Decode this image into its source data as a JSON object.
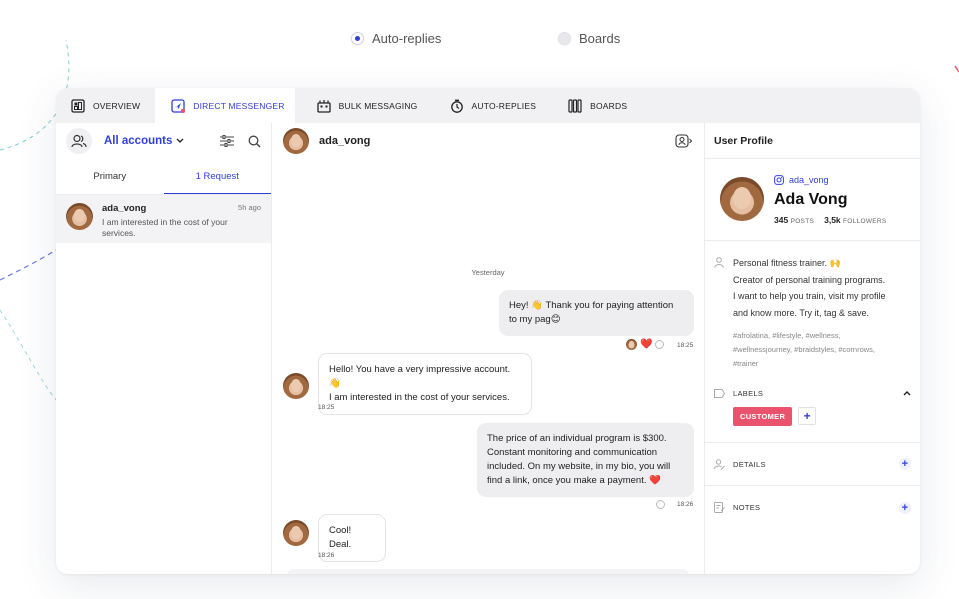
{
  "toggle": {
    "options": [
      {
        "label": "Auto-replies",
        "selected": true
      },
      {
        "label": "Boards",
        "selected": false
      }
    ]
  },
  "tabs": [
    {
      "label": "OVERVIEW",
      "icon": "dashboard-icon",
      "active": false
    },
    {
      "label": "DIRECT MESSENGER",
      "icon": "messenger-icon",
      "active": true
    },
    {
      "label": "BULK MESSAGING",
      "icon": "bulk-icon",
      "active": false
    },
    {
      "label": "AUTO-REPLIES",
      "icon": "timer-icon",
      "active": false
    },
    {
      "label": "BOARDS",
      "icon": "boards-icon",
      "active": false
    }
  ],
  "inbox": {
    "account_label": "All accounts",
    "subtabs": [
      "Primary",
      "1 Request"
    ],
    "conversation": {
      "name": "ada_vong",
      "time": "5h ago",
      "snippet": "I am interested in the cost of your services."
    }
  },
  "chat": {
    "contact": "ada_vong",
    "day_separator": "Yesterday",
    "messages": [
      {
        "dir": "out",
        "line1": "Hey! 👋  Thank you for paying attention",
        "line2": "to my pag😊",
        "time": "18:25"
      },
      {
        "dir": "in",
        "line1": "Hello! You have a very impressive account.👋",
        "line2": "I am interested in the cost of your services.",
        "time": "18:25"
      },
      {
        "dir": "out",
        "line1": "The price of an individual program is $300.",
        "line2": "Constant monitoring and communication",
        "line3": "included. On my website, in my bio, you will",
        "line4": "find a link, once you make a payment. ❤️",
        "time": "18:26"
      },
      {
        "dir": "in",
        "line1": "Cool! Deal.",
        "time": "18:26"
      }
    ],
    "reaction": "❤️"
  },
  "profile": {
    "title": "User Profile",
    "handle": "ada_vong",
    "name": "Ada Vong",
    "posts_count": "345",
    "posts_label": "POSTS",
    "followers_count": "3,5k",
    "followers_label": "FOLLOWERS",
    "bio": [
      "Personal fitness trainer. 🙌",
      "Creator of personal training programs.",
      "I want to help you train, visit my profile",
      "and know more. Try it, tag & save."
    ],
    "tags": [
      "#afrolatina, #lifestyle, #wellness,",
      "#wellnessjourney, #braidstyles, #cornrows,",
      "#trainer"
    ],
    "labels_title": "LABELS",
    "label_chip": "CUSTOMER",
    "details_title": "DETAILS",
    "notes_title": "NOTES"
  },
  "colors": {
    "accent": "#2f3fd9",
    "chip": "#e9536e",
    "tabbar": "#f1f1f3"
  }
}
